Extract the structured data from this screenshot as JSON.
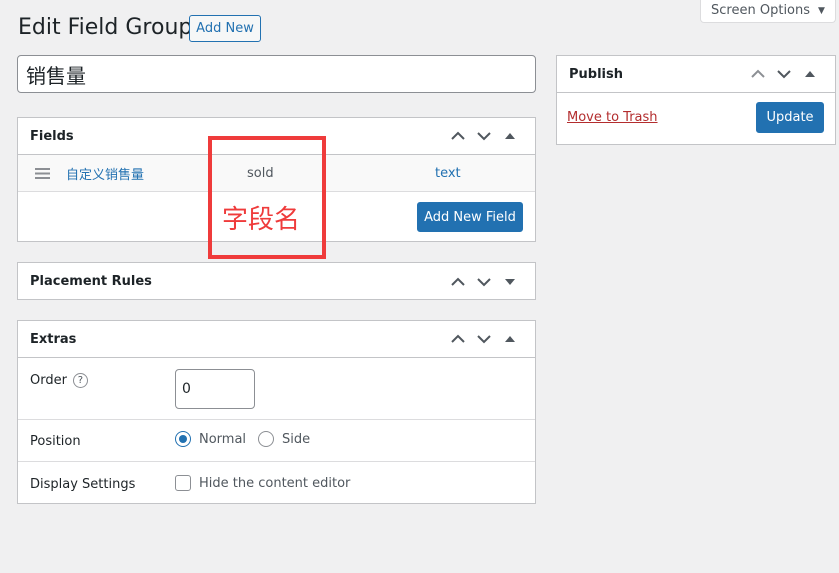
{
  "screen_options": {
    "label": "Screen Options"
  },
  "header": {
    "title": "Edit Field Group",
    "add_new_label": "Add New"
  },
  "title_input": {
    "value": "销售量"
  },
  "fields_box": {
    "title": "Fields",
    "rows": [
      {
        "label": "自定义销售量",
        "name": "sold",
        "type": "text"
      }
    ],
    "add_field_label": "Add New Field"
  },
  "placement_box": {
    "title": "Placement Rules"
  },
  "extras_box": {
    "title": "Extras",
    "order": {
      "label": "Order",
      "help": "?",
      "value": "0"
    },
    "position": {
      "label": "Position",
      "options": [
        "Normal",
        "Side"
      ],
      "selected": "Normal"
    },
    "display": {
      "label": "Display Settings",
      "checkbox_label": "Hide the content editor",
      "checked": false
    }
  },
  "publish_box": {
    "title": "Publish",
    "trash_label": "Move to Trash",
    "update_label": "Update"
  },
  "annotation": {
    "text": "字段名"
  },
  "colors": {
    "accent": "#2271b1",
    "danger": "#b32d2e",
    "annotation": "#ef3b3b"
  }
}
